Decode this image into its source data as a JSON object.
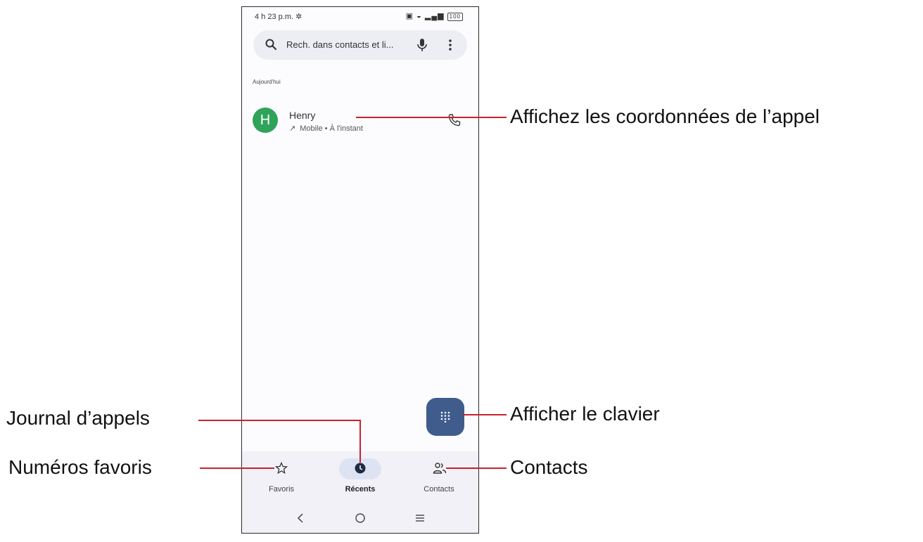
{
  "status_bar": {
    "time": "4 h 23 p.m.",
    "battery": "100"
  },
  "search": {
    "placeholder": "Rech. dans contacts et li..."
  },
  "section_header": "Aujourd'hui",
  "call": {
    "avatar_letter": "H",
    "name": "Henry",
    "detail": "Mobile • À l'instant",
    "avatar_color": "#2fa35a"
  },
  "bottom_nav": {
    "items": [
      {
        "label": "Favoris",
        "icon": "star-icon"
      },
      {
        "label": "Récents",
        "icon": "clock-icon",
        "active": true
      },
      {
        "label": "Contacts",
        "icon": "people-icon"
      }
    ]
  },
  "system_nav": [
    "back-icon",
    "home-icon",
    "recents-icon"
  ],
  "callouts": {
    "call_details": "Affichez les coordonnées de l’appel",
    "call_log": "Journal d’appels",
    "show_keypad": "Afficher le clavier",
    "favorites": "Numéros favoris",
    "contacts": "Contacts"
  },
  "colors": {
    "accent": "#3f5c8d",
    "callout_line": "#c9202e"
  }
}
